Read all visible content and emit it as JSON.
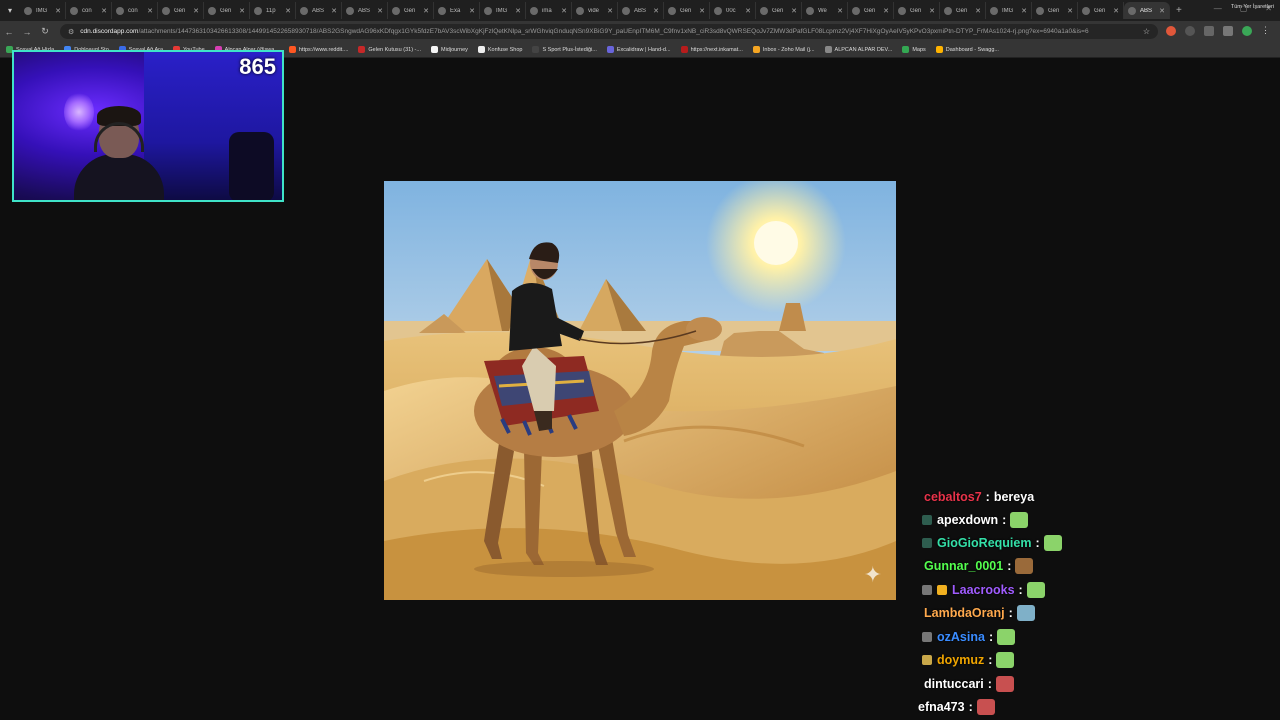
{
  "browser": {
    "tabs": [
      {
        "label": "IMG"
      },
      {
        "label": "con"
      },
      {
        "label": "con"
      },
      {
        "label": "Gen"
      },
      {
        "label": "Gen"
      },
      {
        "label": "11p"
      },
      {
        "label": "ABS"
      },
      {
        "label": "ABS"
      },
      {
        "label": "Gen"
      },
      {
        "label": "Exa"
      },
      {
        "label": "IMG"
      },
      {
        "label": "ima"
      },
      {
        "label": "vide"
      },
      {
        "label": "ABS"
      },
      {
        "label": "Gen"
      },
      {
        "label": "00c"
      },
      {
        "label": "Gen"
      },
      {
        "label": "We"
      },
      {
        "label": "Gen"
      },
      {
        "label": "Gen"
      },
      {
        "label": "Gen"
      },
      {
        "label": "IMG"
      },
      {
        "label": "Gen"
      },
      {
        "label": "Gen"
      },
      {
        "label": "ABS",
        "active": true
      }
    ],
    "url_host": "cdn.discordapp.com",
    "url_path": "/attachments/1447363103426613308/1449914522658930718/ABS2GSngwdAG96xKDfqgx1GYk5fdzE7bAV3scWibXgKjFzlQetKNlpa_srWGhviqGnduqNSn9XBiG9Y_paUEnpITM6M_C9fnv1xNB_ciR3sd8vQWRSEQoJv7ZMW3dPafGLF08Lcpmz2Vj4XF7HiXgOyAeIV5yKPvO3pxmiPtn-DTYP_FrMAs1024-rj.png?ex=6940a1a0&is=6",
    "bookmarks": [
      {
        "label": "Sosyal Ağ Hizla",
        "color": "#3aa757"
      },
      {
        "label": "Dobloaugl Sto",
        "color": "#4285f4"
      },
      {
        "label": "Sosyal Ağ Ara",
        "color": "#3a6be8"
      },
      {
        "label": "YouTube",
        "color": "#e53935"
      },
      {
        "label": "Alpcan Alpar (@swa...",
        "color": "#d63fb3"
      },
      {
        "label": "https://www.reddit....",
        "color": "#ff5722"
      },
      {
        "label": "Gelen Kutusu (31) -...",
        "color": "#c62828"
      },
      {
        "label": "Midjourney",
        "color": "#f5f5f5"
      },
      {
        "label": "Konfuse Shop",
        "color": "#eeeeee"
      },
      {
        "label": "S Sport Plus-İstediği...",
        "color": "#444444"
      },
      {
        "label": "Excalidraw | Hand-d...",
        "color": "#6965db"
      },
      {
        "label": "https://next.inkamat...",
        "color": "#b71c1c"
      },
      {
        "label": "Inbox - Zoho Mail (j...",
        "color": "#f5a623"
      },
      {
        "label": "ALPCAN ALPAR DEV...",
        "color": "#888888"
      },
      {
        "label": "Maps",
        "color": "#34a853"
      },
      {
        "label": "Dashboard - Swagg...",
        "color": "#ffb300"
      }
    ],
    "all_bookmarks_label": "Tüm Yer İşaretleri"
  },
  "stream": {
    "viewer_count": "865"
  },
  "chat": {
    "messages": [
      {
        "user": "cebaltos7",
        "user_color": "#e8334a",
        "text": "bereya",
        "badges": [],
        "emote": null
      },
      {
        "user": "apexdown",
        "user_color": "#ffffff",
        "text": "",
        "badges": [
          "#2e5d4f"
        ],
        "emote": "#8bd36a"
      },
      {
        "user": "GioGioRequiem",
        "user_color": "#34e0a8",
        "text": "",
        "badges": [
          "#2e5d4f"
        ],
        "emote": "#8bd36a"
      },
      {
        "user": "Gunnar_0001",
        "user_color": "#54ff4f",
        "text": "",
        "badges": [],
        "emote": "#9a6a3a"
      },
      {
        "user": "Laacrooks",
        "user_color": "#a05cff",
        "text": "",
        "badges": [
          "#777777",
          "#f0b020"
        ],
        "emote": "#8bd36a"
      },
      {
        "user": "LambdaOranj",
        "user_color": "#ffa94d",
        "text": "",
        "badges": [],
        "emote": "#7fb0c8"
      },
      {
        "user": "ozAsina",
        "user_color": "#3a8cff",
        "text": "",
        "badges": [
          "#777777"
        ],
        "emote": "#8bd36a"
      },
      {
        "user": "doymuz",
        "user_color": "#f0a500",
        "text": "",
        "badges": [
          "#c9a84a"
        ],
        "emote": "#8bd36a"
      },
      {
        "user": "dintuccari",
        "user_color": "#ffffff",
        "text": "",
        "badges": [],
        "emote": "#c85050"
      },
      {
        "user": "efna473",
        "user_color": "#ffffff",
        "text": "",
        "badges": [],
        "emote": "#c85050"
      }
    ]
  }
}
